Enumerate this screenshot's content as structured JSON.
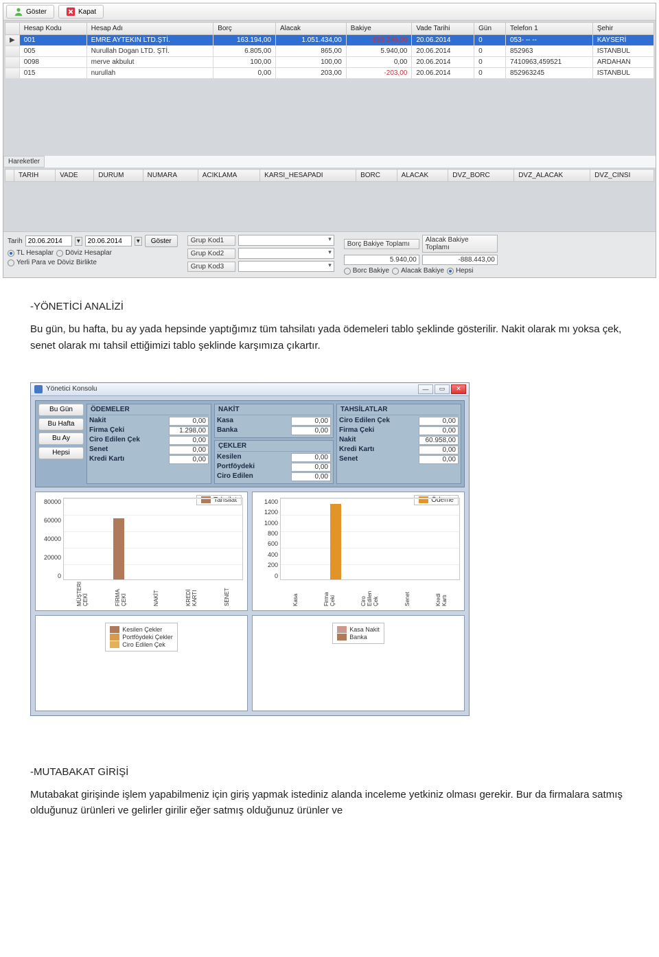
{
  "app1": {
    "toolbar": {
      "show": "Göster",
      "close": "Kapat"
    },
    "grid1": {
      "headers": [
        "Hesap Kodu",
        "Hesap Adı",
        "Borç",
        "Alacak",
        "Bakiye",
        "Vade Tarihi",
        "Gün",
        "Telefon 1",
        "Şehir"
      ],
      "rows": [
        {
          "kod": "001",
          "adi": "EMRE AYTEKIN LTD.ŞTİ.",
          "borc": "163.194,00",
          "alacak": "1.051.434,00",
          "bakiye": "-888.240,00",
          "vade": "20.06.2014",
          "gun": "0",
          "tel": "053- -- --",
          "sehir": "KAYSERİ",
          "sel": true
        },
        {
          "kod": "005",
          "adi": "Nurullah Dogan LTD. ŞTİ.",
          "borc": "6.805,00",
          "alacak": "865,00",
          "bakiye": "5.940,00",
          "vade": "20.06.2014",
          "gun": "0",
          "tel": "852963",
          "sehir": "ISTANBUL"
        },
        {
          "kod": "0098",
          "adi": "merve akbulut",
          "borc": "100,00",
          "alacak": "100,00",
          "bakiye": "0,00",
          "vade": "20.06.2014",
          "gun": "0",
          "tel": "7410963,459521",
          "sehir": "ARDAHAN"
        },
        {
          "kod": "015",
          "adi": "nurullah",
          "borc": "0,00",
          "alacak": "203,00",
          "bakiye": "-203,00",
          "vade": "20.06.2014",
          "gun": "0",
          "tel": "852963245",
          "sehir": "ISTANBUL"
        }
      ]
    },
    "hareketler_label": "Hareketler",
    "grid2": {
      "headers": [
        "TARIH",
        "VADE",
        "DURUM",
        "NUMARA",
        "ACIKLAMA",
        "KARSI_HESAPADI",
        "BORC",
        "ALACAK",
        "DVZ_BORC",
        "DVZ_ALACAK",
        "DVZ_CINSI"
      ]
    },
    "filters": {
      "tarih_label": "Tarih",
      "date_from": "20.06.2014",
      "date_to": "20.06.2014",
      "goster": "Göster",
      "r1": "TL Hesaplar",
      "r2": "Döviz Hesaplar",
      "r3": "Yerli Para ve Döviz Birlikte",
      "g1": "Grup Kod1",
      "g2": "Grup Kod2",
      "g3": "Grup Kod3",
      "th1": "Borç Bakiye Toplamı",
      "th2": "Alacak Bakiye Toplamı",
      "tv1": "5.940,00",
      "tv2": "-888.443,00",
      "rb1": "Borc Bakiye",
      "rb2": "Alacak Bakiye",
      "rb3": "Hepsi"
    }
  },
  "text1": {
    "heading": "-YÖNETİCİ ANALİZİ",
    "body": "Bu gün, bu hafta, bu ay  yada hepsinde yaptığımız tüm tahsilatı yada ödemeleri  tablo şeklinde gösterilir. Nakit olarak mı yoksa çek, senet olarak mı tahsil ettiğimizi tablo şeklinde karşımıza çıkartır."
  },
  "app2": {
    "title": "Yönetici Konsolu",
    "side": [
      "Bu Gün",
      "Bu Hafta",
      "Bu Ay",
      "Hepsi"
    ],
    "odemeler": {
      "hdr": "ÖDEMELER",
      "items": [
        {
          "k": "Nakit",
          "v": "0,00"
        },
        {
          "k": "Firma Çeki",
          "v": "1.298,00"
        },
        {
          "k": "Ciro Edilen Çek",
          "v": "0,00"
        },
        {
          "k": "Senet",
          "v": "0,00"
        },
        {
          "k": "Kredi Kartı",
          "v": "0,00"
        }
      ]
    },
    "nakit": {
      "hdr": "NAKİT",
      "items": [
        {
          "k": "Kasa",
          "v": "0,00"
        },
        {
          "k": "Banka",
          "v": "0,00"
        }
      ]
    },
    "cekler": {
      "hdr": "ÇEKLER",
      "items": [
        {
          "k": "Kesilen",
          "v": "0,00"
        },
        {
          "k": "Portföydeki",
          "v": "0,00"
        },
        {
          "k": "Ciro Edilen",
          "v": "0,00"
        }
      ]
    },
    "tahsilatlar": {
      "hdr": "TAHSİLATLAR",
      "items": [
        {
          "k": "Ciro Edilen Çek",
          "v": "0,00"
        },
        {
          "k": "Firma Çeki",
          "v": "0,00"
        },
        {
          "k": "Nakit",
          "v": "60.958,00"
        },
        {
          "k": "Kredi Kartı",
          "v": "0,00"
        },
        {
          "k": "Senet",
          "v": "0,00"
        }
      ]
    },
    "legend1": "Tahsilat",
    "legend2": "Ödeme",
    "lblocks": {
      "l1": [
        "Kesilen Çekler",
        "Portföydeki Çekler",
        "Ciro Edilen Çek"
      ],
      "l2": [
        "Kasa Nakit",
        "Banka"
      ]
    }
  },
  "text2": {
    "heading": "-MUTABAKAT GİRİŞİ",
    "body": "Mutabakat girişinde işlem yapabilmeniz için giriş yapmak istediniz alanda inceleme yetkiniz olması gerekir. Bur da firmalara satmış olduğunuz ürünleri ve gelirler girilir eğer satmış olduğunuz ürünler ve"
  },
  "chart_data": [
    {
      "type": "bar",
      "title": "Tahsilat",
      "categories": [
        "MÜŞTERI ÇEKİ",
        "FİRMA ÇEKİ",
        "NAKİT",
        "KREDİ KARTI",
        "SENET"
      ],
      "values": [
        0,
        60000,
        0,
        0,
        0
      ],
      "ylim": [
        0,
        80000
      ],
      "yticks": [
        0,
        20000,
        40000,
        60000,
        80000
      ],
      "color": "#b07a5a"
    },
    {
      "type": "bar",
      "title": "Ödeme",
      "categories": [
        "Kasa",
        "Firma Çeki",
        "Ciro Edilen Çek",
        "Senet",
        "Kredi Kartı"
      ],
      "values": [
        0,
        1300,
        0,
        0,
        0
      ],
      "ylim": [
        0,
        1400
      ],
      "yticks": [
        0,
        200,
        400,
        600,
        800,
        1000,
        1200,
        1400
      ],
      "color": "#e39428"
    }
  ]
}
